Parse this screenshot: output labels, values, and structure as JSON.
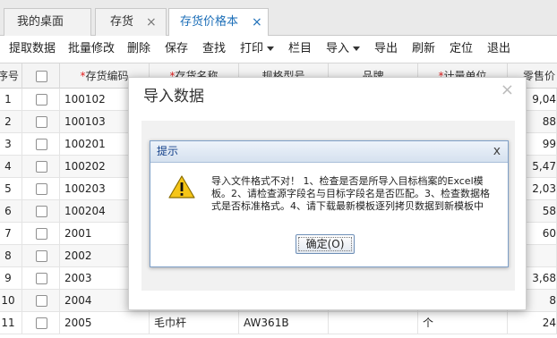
{
  "tabs": [
    {
      "label": "我的桌面",
      "closable": false,
      "active": false
    },
    {
      "label": "存货",
      "closable": true,
      "active": false
    },
    {
      "label": "存货价格本",
      "closable": true,
      "active": true
    }
  ],
  "toolbar": {
    "fetch": "提取数据",
    "batch_edit": "批量修改",
    "delete": "删除",
    "save": "保存",
    "find": "查找",
    "print": "打印",
    "columns": "栏目",
    "import": "导入",
    "export": "导出",
    "refresh": "刷新",
    "locate": "定位",
    "exit": "退出"
  },
  "grid": {
    "columns": {
      "seq": "序号",
      "code": "存货编码",
      "name": "存货名称",
      "spec": "规格型号",
      "brand": "品牌",
      "unit": "计量单位",
      "price": "零售价"
    },
    "required_mark": "*",
    "rows": [
      {
        "seq": "1",
        "code": "100102",
        "name": "",
        "spec": "",
        "unit": "",
        "price": "9,04"
      },
      {
        "seq": "2",
        "code": "100103",
        "name": "",
        "spec": "",
        "unit": "",
        "price": "88"
      },
      {
        "seq": "3",
        "code": "100201",
        "name": "",
        "spec": "",
        "unit": "",
        "price": "99"
      },
      {
        "seq": "4",
        "code": "100202",
        "name": "",
        "spec": "",
        "unit": "",
        "price": "5,47"
      },
      {
        "seq": "5",
        "code": "100203",
        "name": "",
        "spec": "",
        "unit": "",
        "price": "2,03"
      },
      {
        "seq": "6",
        "code": "100204",
        "name": "",
        "spec": "",
        "unit": "",
        "price": "58"
      },
      {
        "seq": "7",
        "code": "2001",
        "name": "",
        "spec": "",
        "unit": "",
        "price": "60"
      },
      {
        "seq": "8",
        "code": "2002",
        "name": "",
        "spec": "",
        "unit": "",
        "price": ""
      },
      {
        "seq": "9",
        "code": "2003",
        "name": "",
        "spec": "",
        "unit": "",
        "price": "3,68"
      },
      {
        "seq": "10",
        "code": "2004",
        "name": "",
        "spec": "",
        "unit": "",
        "price": "8"
      },
      {
        "seq": "11",
        "code": "2005",
        "name": "毛巾杆",
        "spec": "AW361B",
        "unit": "个",
        "price": "24"
      }
    ]
  },
  "dialog": {
    "title": "导入数据",
    "close": "×"
  },
  "alert": {
    "title": "提示",
    "close": "x",
    "message": "导入文件格式不对！ 1、检查是否是所导入目标档案的Excel模板。2、请检查源字段名与目标字段名是否匹配。3、检查数据格式是否标准格式。4、请下载最新模板逐列拷贝数据到新模板中",
    "ok_button": "确定(O)"
  },
  "colors": {
    "accent": "#1d6fb8",
    "required": "#e02020",
    "alert_title": "#15428b"
  }
}
